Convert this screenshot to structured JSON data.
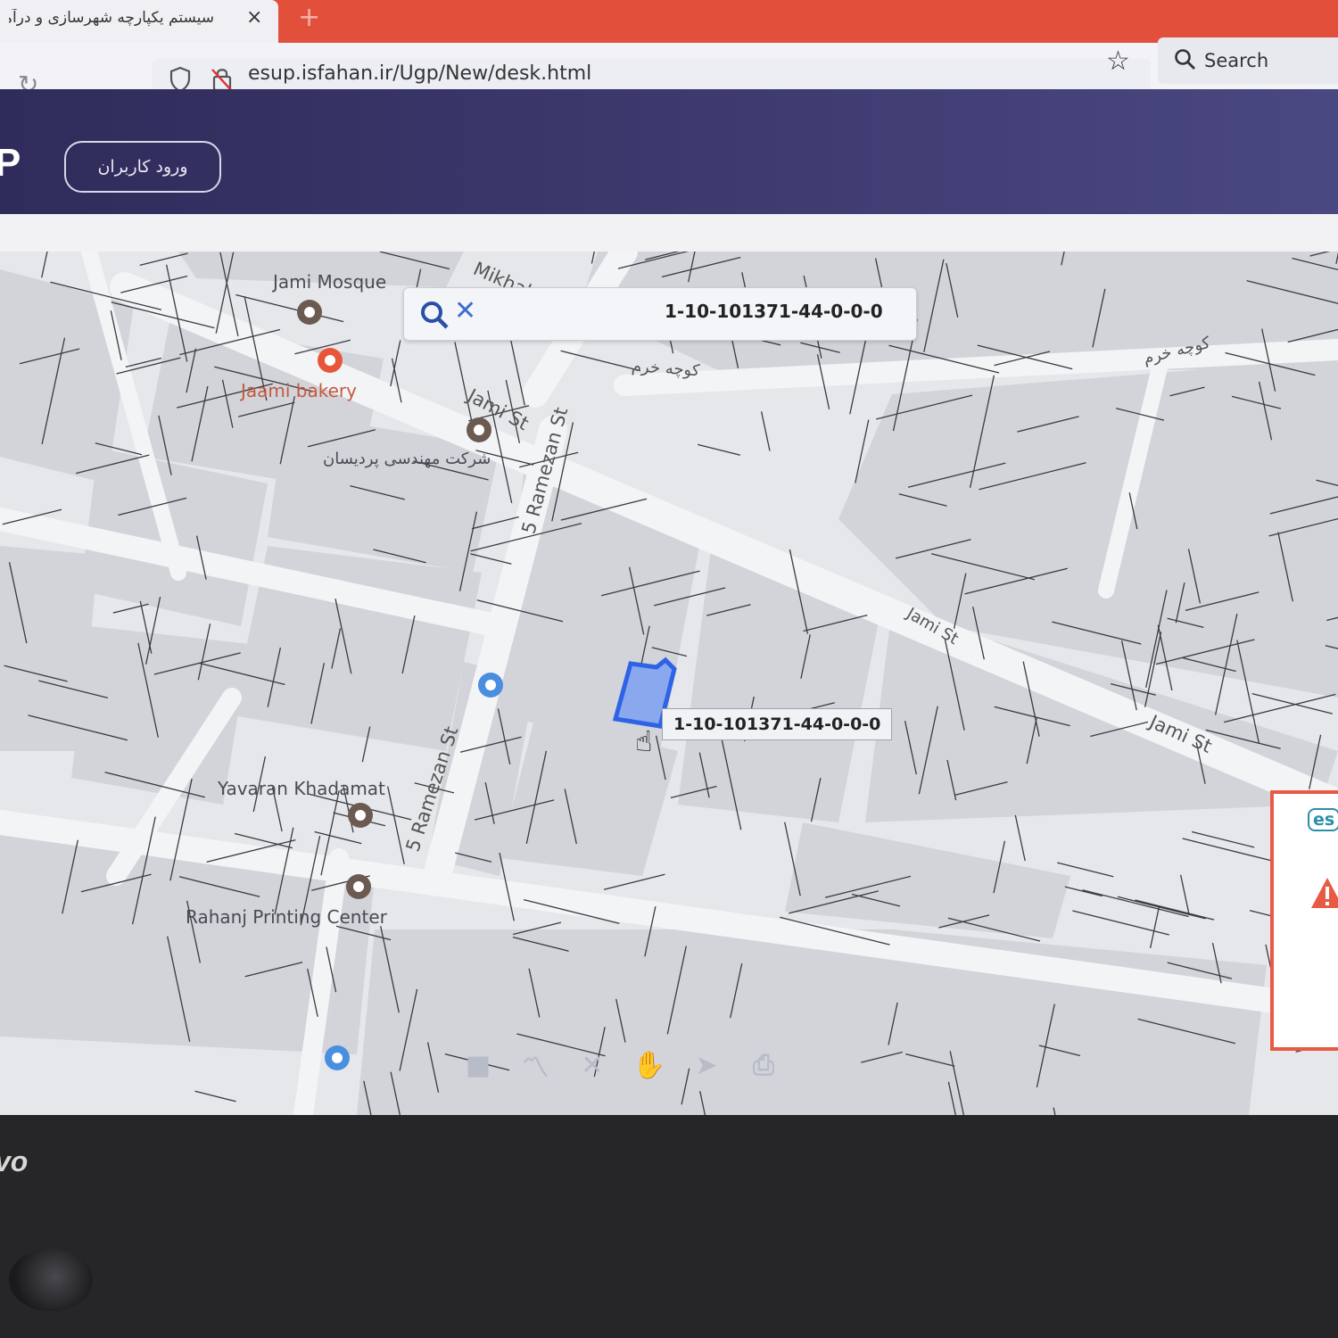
{
  "browser": {
    "tab_title": "سیستم یکپارچه شهرسازی و درآمد.",
    "tab_close": "×",
    "new_tab": "+",
    "url": "esup.isfahan.ir/Ugp/New/desk.html",
    "search_label": "Search"
  },
  "header": {
    "logo": "P",
    "login_label": "ورود کاربران"
  },
  "map": {
    "search_value": "1-10-101371-44-0-0-0",
    "parcel_tooltip": "1-10-101371-44-0-0-0",
    "labels": {
      "jami_mosque": "Jami Mosque",
      "jaami_bakery": "Jaami bakery",
      "company": "شرکت مهندسی پردیسان",
      "yavaran": "Yavaran Khadamat",
      "rahanj": "Rahanj Printing Center",
      "mikhak": "Mikhak",
      "kuche_khorram_1": "کوچه خرم",
      "kuche_khorram_2": "کوچه خرم",
      "jami_st_1": "Jami St",
      "jami_st_2": "Jami St",
      "jami_st_3": "Jami St",
      "ramezan_1": "5 Ramezan St",
      "ramezan_2": "5 Ramezan St"
    },
    "highlight_color": "#2f63e6"
  },
  "panel": {
    "badge": "es"
  },
  "device": {
    "brand": "vo"
  }
}
